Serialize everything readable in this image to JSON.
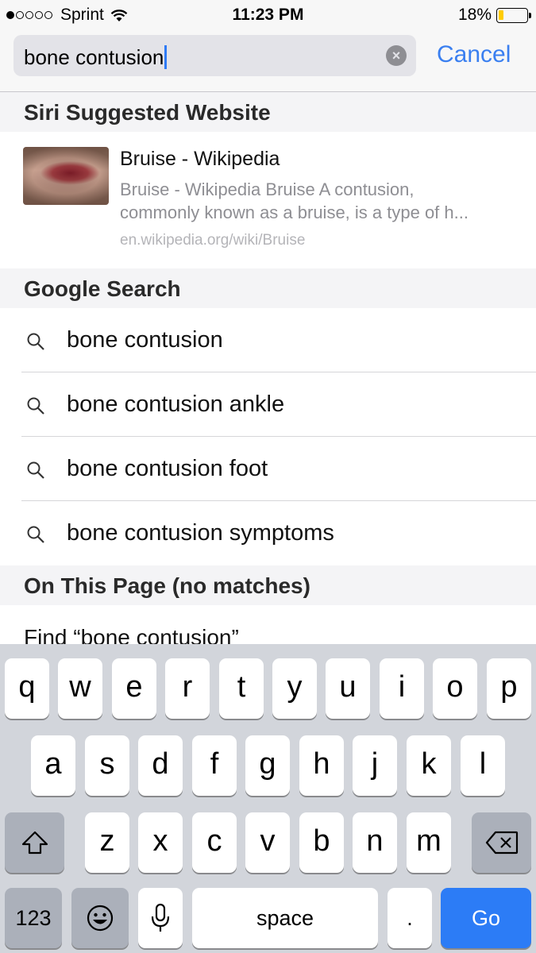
{
  "status_bar": {
    "carrier": "Sprint",
    "time": "11:23 PM",
    "battery_percent": "18%",
    "battery_level": 0.18,
    "signal_bars": 1,
    "signal_total": 5,
    "wifi_icon": "wifi-icon"
  },
  "search": {
    "query": "bone contusion",
    "cancel_label": "Cancel",
    "clear_icon": "clear-icon"
  },
  "siri_section": {
    "header": "Siri Suggested Website",
    "result": {
      "title": "Bruise - Wikipedia",
      "description_line1": "Bruise - Wikipedia Bruise A contusion,",
      "description_line2": "commonly known as a bruise, is a type of h...",
      "url": "en.wikipedia.org/wiki/Bruise"
    }
  },
  "google_section": {
    "header": "Google Search",
    "suggestions": [
      "bone contusion",
      "bone contusion ankle",
      "bone contusion foot",
      "bone contusion symptoms"
    ]
  },
  "page_section": {
    "header": "On This Page (no matches)",
    "find_label": "Find “bone contusion”"
  },
  "keyboard": {
    "row1": [
      "q",
      "w",
      "e",
      "r",
      "t",
      "y",
      "u",
      "i",
      "o",
      "p"
    ],
    "row2": [
      "a",
      "s",
      "d",
      "f",
      "g",
      "h",
      "j",
      "k",
      "l"
    ],
    "row3": [
      "z",
      "x",
      "c",
      "v",
      "b",
      "n",
      "m"
    ],
    "numbers_label": "123",
    "space_label": "space",
    "period_label": ".",
    "go_label": "Go",
    "colors": {
      "go": "#2c7cf6",
      "background": "#d2d5db",
      "dark_key": "#abb0ba"
    }
  },
  "accent_color": "#3a7ff0"
}
